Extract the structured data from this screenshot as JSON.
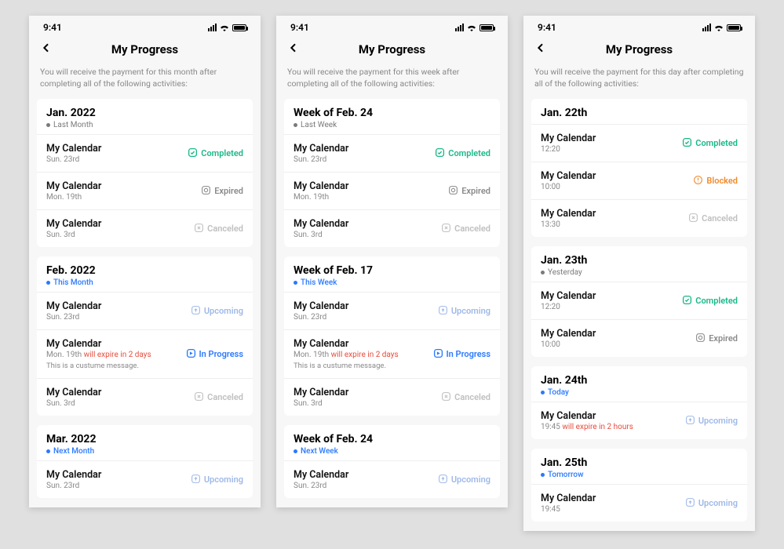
{
  "statusbar": {
    "time": "9:41"
  },
  "header": {
    "title": "My Progress"
  },
  "intro": {
    "month": "You will receive the payment for this month after completing all of the following activities:",
    "week": "You will receive the payment for this week after completing all of the following activities:",
    "day": "You will receive the payment for this day after completing all of the following activities:"
  },
  "entry_name": "My Calendar",
  "status_labels": {
    "completed": "Completed",
    "expired": "Expired",
    "canceled": "Canceled",
    "upcoming": "Upcoming",
    "inprogress": "In Progress",
    "blocked": "Blocked"
  },
  "custom_note": "This is a custume message.",
  "screens": {
    "month": {
      "sections": [
        {
          "title": "Jan. 2022",
          "tag": "Last Month",
          "tag_class": "tag-past",
          "items": [
            {
              "sub": "Sun. 23rd",
              "status": "completed"
            },
            {
              "sub": "Mon. 19th",
              "status": "expired"
            },
            {
              "sub": "Sun. 3rd",
              "status": "canceled"
            }
          ]
        },
        {
          "title": "Feb. 2022",
          "tag": "This Month",
          "tag_class": "tag-current",
          "items": [
            {
              "sub": "Sun. 23rd",
              "status": "upcoming"
            },
            {
              "sub": "Mon. 19th",
              "warn": "will expire in 2 days",
              "status": "inprogress",
              "note": true
            },
            {
              "sub": "Sun. 3rd",
              "status": "canceled"
            }
          ]
        },
        {
          "title": "Mar. 2022",
          "tag": "Next Month",
          "tag_class": "tag-current",
          "items": [
            {
              "sub": "Sun. 23rd",
              "status": "upcoming"
            }
          ]
        }
      ]
    },
    "week": {
      "sections": [
        {
          "title": "Week of Feb. 24",
          "tag": "Last Week",
          "tag_class": "tag-past",
          "items": [
            {
              "sub": "Sun. 23rd",
              "status": "completed"
            },
            {
              "sub": "Mon. 19th",
              "status": "expired"
            },
            {
              "sub": "Sun. 3rd",
              "status": "canceled"
            }
          ]
        },
        {
          "title": "Week of Feb. 17",
          "tag": "This Week",
          "tag_class": "tag-current",
          "items": [
            {
              "sub": "Sun. 23rd",
              "status": "upcoming"
            },
            {
              "sub": "Mon. 19th",
              "warn": "will expire in 2 days",
              "status": "inprogress",
              "note": true
            },
            {
              "sub": "Sun. 3rd",
              "status": "canceled"
            }
          ]
        },
        {
          "title": "Week of Feb. 24",
          "tag": "Next Week",
          "tag_class": "tag-current",
          "items": [
            {
              "sub": "Sun. 23rd",
              "status": "upcoming"
            }
          ]
        }
      ]
    },
    "day": {
      "sections": [
        {
          "title": "Jan. 22th",
          "tag": "",
          "tag_class": "",
          "items": [
            {
              "sub": "12:20",
              "status": "completed"
            },
            {
              "sub": "10:00",
              "status": "blocked"
            },
            {
              "sub": "13:30",
              "status": "canceled"
            }
          ]
        },
        {
          "title": "Jan. 23th",
          "tag": "Yesterday",
          "tag_class": "tag-past",
          "items": [
            {
              "sub": "12:20",
              "status": "completed"
            },
            {
              "sub": "10:00",
              "status": "expired"
            }
          ]
        },
        {
          "title": "Jan. 24th",
          "tag": "Today",
          "tag_class": "tag-current",
          "items": [
            {
              "sub": "19:45",
              "warn": "will expire in 2 hours",
              "status": "upcoming"
            }
          ]
        },
        {
          "title": "Jan. 25th",
          "tag": "Tomorrow",
          "tag_class": "tag-current",
          "items": [
            {
              "sub": "19:45",
              "status": "upcoming"
            }
          ]
        }
      ]
    }
  }
}
